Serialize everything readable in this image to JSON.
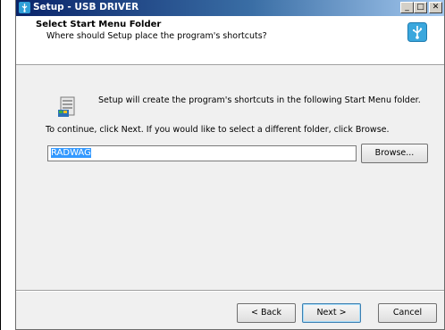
{
  "window": {
    "title": "Setup - USB DRIVER",
    "controls": [
      "_",
      "□",
      "✕"
    ]
  },
  "header": {
    "title": "Select Start Menu Folder",
    "subtitle": "Where should Setup place the program's shortcuts?"
  },
  "main": {
    "info_text": "Setup will create the program's shortcuts in the following Start Menu folder.",
    "instruction_text": "To continue, click Next. If you would like to select a different folder, click Browse.",
    "folder_value": "RADWAG",
    "browse_label": "Browse..."
  },
  "footer": {
    "back_label": "< Back",
    "next_label": "Next >",
    "cancel_label": "Cancel"
  },
  "icons": {
    "titlebar": "usb-setup-icon",
    "header": "usb-icon",
    "folder": "start-menu-folder-icon"
  },
  "colors": {
    "titlebar": "#0a246a",
    "selection": "#3399ff",
    "dialog_bg": "#f0f0f0"
  }
}
